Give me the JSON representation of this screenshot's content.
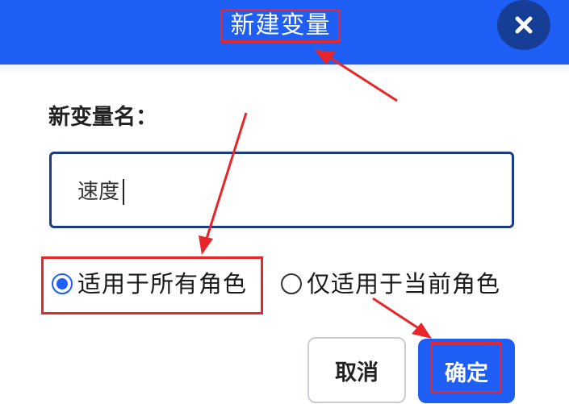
{
  "dialog": {
    "title": "新建变量",
    "close_icon": "close-icon"
  },
  "form": {
    "name_label": "新变量名：",
    "name_value": "速度"
  },
  "scope": {
    "options": [
      {
        "label": "适用于所有角色",
        "checked": true
      },
      {
        "label": "仅适用于当前角色",
        "checked": false
      }
    ]
  },
  "buttons": {
    "cancel_label": "取消",
    "confirm_label": "确定"
  },
  "colors": {
    "accent": "#1f5ef4",
    "annotation": "#e8262a",
    "close_bg": "#173e96"
  }
}
